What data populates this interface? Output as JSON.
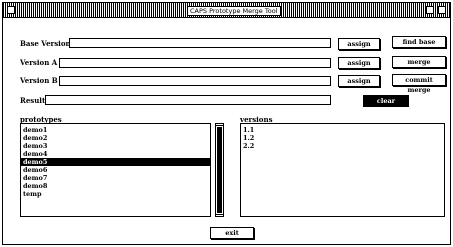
{
  "window": {
    "title": "CAPS Prototype Merge Tool"
  },
  "form": {
    "base_version_label": "Base Version",
    "version_a_label": "Version A",
    "version_b_label": "Version B",
    "result_label": "Result",
    "base_version_value": "",
    "version_a_value": "",
    "version_b_value": "",
    "result_value": ""
  },
  "buttons": {
    "assign": "assign",
    "find_base": "find base",
    "merge": "merge",
    "commit_merge": "commit merge",
    "clear": "clear",
    "exit": "exit"
  },
  "prototypes": {
    "label": "prototypes",
    "items": [
      "demo1",
      "demo2",
      "demo3",
      "demo4",
      "demo5",
      "demo6",
      "demo7",
      "demo8",
      "temp"
    ],
    "selected_index": 4
  },
  "versions": {
    "label": "versions",
    "items": [
      "1.1",
      "1.2",
      "2.2"
    ]
  }
}
